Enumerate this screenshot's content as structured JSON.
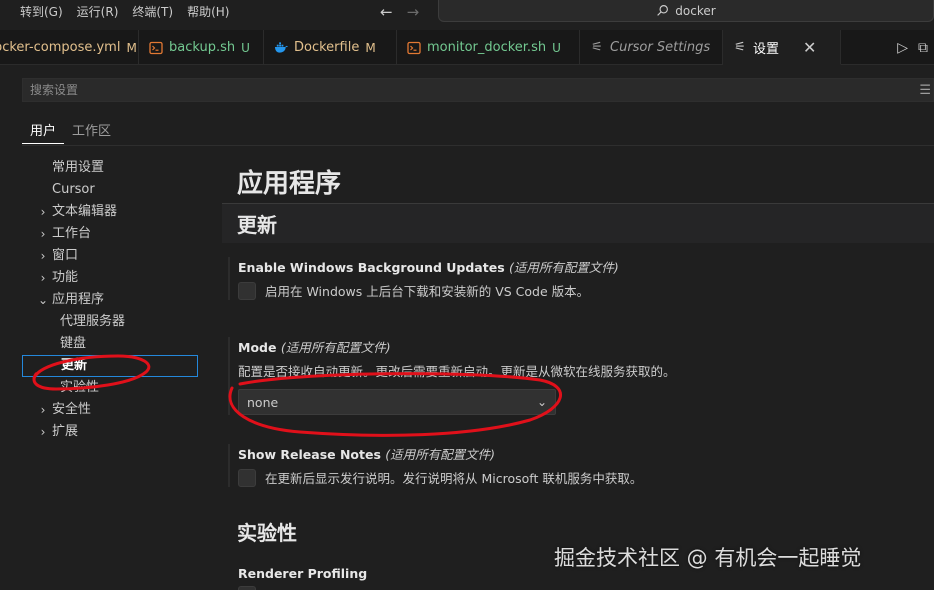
{
  "menu": [
    "转到(G)",
    "运行(R)",
    "终端(T)",
    "帮助(H)"
  ],
  "command_center": {
    "text": "docker"
  },
  "tabs": [
    {
      "label": "docker-compose.yml",
      "status": "M",
      "kind": "modified"
    },
    {
      "label": "backup.sh",
      "status": "U",
      "kind": "untracked"
    },
    {
      "label": "Dockerfile",
      "status": "M",
      "kind": "modified"
    },
    {
      "label": "monitor_docker.sh",
      "status": "U",
      "kind": "untracked"
    },
    {
      "label": "Cursor Settings",
      "status": "",
      "kind": "preview"
    },
    {
      "label": "设置",
      "status": "",
      "kind": "active"
    }
  ],
  "search": {
    "placeholder": "搜索设置"
  },
  "scope_tabs": [
    "用户",
    "工作区"
  ],
  "toc": [
    {
      "label": "常用设置",
      "chevron": "none",
      "level": 0
    },
    {
      "label": "Cursor",
      "chevron": "none",
      "level": 0
    },
    {
      "label": "文本编辑器",
      "chevron": "right",
      "level": 0
    },
    {
      "label": "工作台",
      "chevron": "right",
      "level": 0
    },
    {
      "label": "窗口",
      "chevron": "right",
      "level": 0
    },
    {
      "label": "功能",
      "chevron": "right",
      "level": 0
    },
    {
      "label": "应用程序",
      "chevron": "down",
      "level": 0
    },
    {
      "label": "代理服务器",
      "chevron": "none",
      "level": 1
    },
    {
      "label": "键盘",
      "chevron": "none",
      "level": 1
    },
    {
      "label": "更新",
      "chevron": "none",
      "level": 1,
      "selected": true
    },
    {
      "label": "实验性",
      "chevron": "none",
      "level": 1
    },
    {
      "label": "安全性",
      "chevron": "right",
      "level": 0
    },
    {
      "label": "扩展",
      "chevron": "right",
      "level": 0
    }
  ],
  "content": {
    "section_title": "应用程序",
    "group_title": "更新",
    "next_group_title": "实验性",
    "settings": {
      "background_updates": {
        "title": "Enable Windows Background Updates",
        "scope": "(适用所有配置文件)",
        "checkbox_label": "启用在 Windows 上后台下载和安装新的 VS Code 版本。"
      },
      "mode": {
        "title": "Mode",
        "scope": "(适用所有配置文件)",
        "description": "配置是否接收自动更新。更改后需要重新启动。更新是从微软在线服务获取的。",
        "value": "none"
      },
      "release_notes": {
        "title": "Show Release Notes",
        "scope": "(适用所有配置文件)",
        "checkbox_label": "在更新后显示发行说明。发行说明将从 Microsoft 联机服务中获取。"
      },
      "renderer_profiling": {
        "title": "Renderer Profiling"
      }
    }
  },
  "watermark": "掘金技术社区 @ 有机会一起睡觉",
  "colors": {
    "accent": "#2488db",
    "modified": "#e2c08d",
    "untracked": "#73c991",
    "annotation": "#e0101a"
  }
}
